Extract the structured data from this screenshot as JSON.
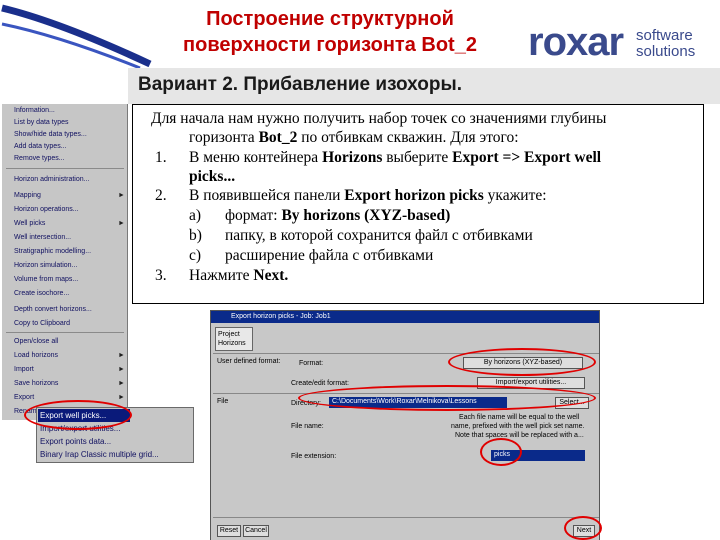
{
  "header": {
    "title_line1": "Построение структурной",
    "title_line2": "поверхности горизонта Bot_2",
    "subtitle": "Вариант 2. Прибавление изохоры.",
    "logo_word": "roxar",
    "logo_line1": "software",
    "logo_line2": "solutions"
  },
  "context_menu": {
    "items": [
      "Information...",
      "List by data types",
      "Show/hide data types...",
      "Add data types...",
      "Remove types...",
      "Horizon administration...",
      "Mapping",
      "Horizon operations...",
      "Well picks",
      "Well intersection...",
      "Stratigraphic modelling...",
      "Horizon simulation...",
      "Volume from maps...",
      "Create isochore...",
      "Depth convert horizons...",
      "Copy to Clipboard",
      "Open/close all",
      "Load horizons",
      "Import",
      "Save horizons",
      "Export",
      "Rename"
    ],
    "arrow": "►"
  },
  "export_submenu": {
    "items": [
      "Export well picks...",
      "Import/export utilities...",
      "Export points data...",
      "Binary Irap Classic multiple grid..."
    ]
  },
  "instructions": {
    "intro_1": "Для начала нам нужно получить набор точек со значениями глубины",
    "intro_2a": "горизонта ",
    "intro_2b": "Bot_2",
    "intro_2c": " по отбивкам скважин. Для этого:",
    "step1_num": "1.",
    "step1_a": "В меню контейнера ",
    "step1_b": "Horizons",
    "step1_c": " выберите ",
    "step1_d": "Export => Export well",
    "step1_e": "picks...",
    "step2_num": "2.",
    "step2_a": "В появившейся панели ",
    "step2_b": "Export horizon picks",
    "step2_c": " укажите:",
    "sub_a_letter": "a)",
    "sub_a_text": "формат: ",
    "sub_a_bold": "By horizons (XYZ-based)",
    "sub_b_letter": "b)",
    "sub_b_text": "папку, в которой сохранится файл с отбивками",
    "sub_c_letter": "c)",
    "sub_c_text": "расширение файла с отбивками",
    "step3_num": "3.",
    "step3_a": "Нажмите ",
    "step3_b": "Next."
  },
  "dialog": {
    "title": "Export horizon picks - Job: Job1",
    "tab_line1": "Project",
    "tab_line2": "Horizons",
    "user_defined_format": "User defined format:",
    "format_label": "Format:",
    "format_value": "By horizons (XYZ-based)",
    "create_edit_format": "Create/edit format:",
    "import_export_utilities": "Import/export utilities...",
    "file_label": "File",
    "directory_label": "Directory:",
    "directory_value": "C:\\Documents\\Work\\Roxar\\Melnikova\\Lessons",
    "select_button": "Select...",
    "file_name_label": "File name:",
    "note_1": "Each file name will be equal to the well",
    "note_2": "name, prefixed with the well pick set name.",
    "note_3": "Note that spaces will be replaced with a...",
    "file_extension_label": "File extension:",
    "file_extension_value": "picks",
    "reset_button": "Reset",
    "cancel_button": "Cancel",
    "next_button": "Next"
  }
}
